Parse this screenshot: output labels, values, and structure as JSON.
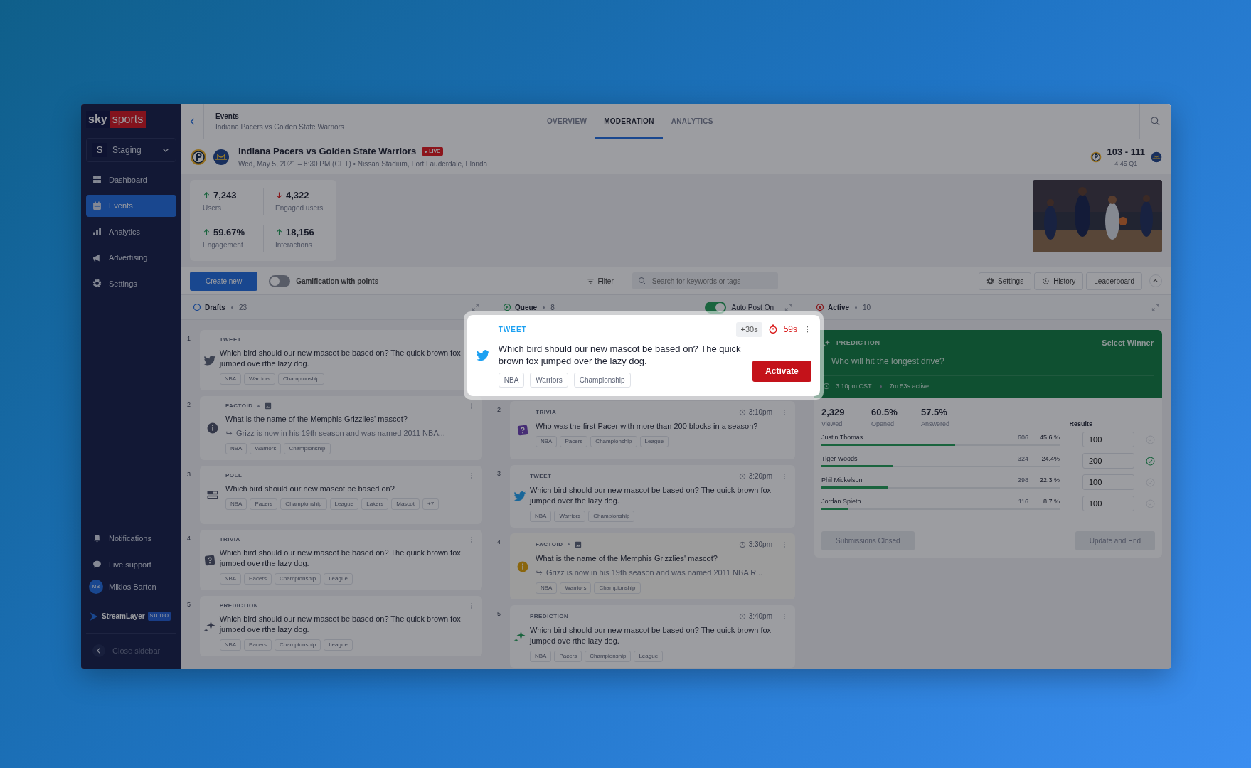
{
  "sidebar": {
    "brand": {
      "first": "sky",
      "second": "sports"
    },
    "workspace": {
      "initial": "S",
      "name": "Staging"
    },
    "nav": [
      {
        "label": "Dashboard",
        "kind": "grid",
        "selected": false
      },
      {
        "label": "Events",
        "kind": "calendar",
        "selected": true
      },
      {
        "label": "Analytics",
        "kind": "bars",
        "selected": false
      },
      {
        "label": "Advertising",
        "kind": "megaphone",
        "selected": false
      },
      {
        "label": "Settings",
        "kind": "gear",
        "selected": false
      }
    ],
    "bottom": [
      {
        "label": "Notifications",
        "kind": "bell"
      },
      {
        "label": "Live support",
        "kind": "chat"
      }
    ],
    "user": {
      "initials": "MB",
      "name": "Miklos Barton"
    },
    "footer": {
      "name": "StreamLayer",
      "badge": "STUDIO"
    },
    "close": "Close sidebar"
  },
  "header": {
    "breadcrumb": {
      "title": "Events",
      "subtitle": "Indiana Pacers vs Golden State Warriors"
    },
    "tabs": [
      {
        "label": "OVERVIEW",
        "selected": false
      },
      {
        "label": "MODERATION",
        "selected": true
      },
      {
        "label": "ANALYTICS",
        "selected": false
      }
    ],
    "event": {
      "title": "Indiana Pacers vs Golden State Warriors",
      "live": "LIVE",
      "meta": "Wed, May 5, 2021 – 8:30 PM (CET) • Nissan Stadium, Fort Lauderdale, Florida"
    },
    "score": {
      "value": "103 - 111",
      "clock": "4:45 Q1"
    }
  },
  "stats": [
    {
      "value": "7,243",
      "label": "Users",
      "rising": true
    },
    {
      "value": "4,322",
      "label": "Engaged users",
      "rising": false
    },
    {
      "value": "59.67%",
      "label": "Engagement",
      "rising": true
    },
    {
      "value": "18,156",
      "label": "Interactions",
      "rising": true
    }
  ],
  "toolbar": {
    "create": "Create new",
    "gamification": {
      "label": "Gamification with points",
      "on": false
    },
    "filter": "Filter",
    "search": {
      "placeholder": "Search for keywords or tags"
    },
    "buttons": [
      {
        "label": "Settings",
        "kind": "gear"
      },
      {
        "label": "History",
        "kind": "history"
      },
      {
        "label": "Leaderboard",
        "kind": "none"
      }
    ]
  },
  "drafts": {
    "title": "Drafts",
    "count": "23",
    "cards": [
      {
        "number": "1",
        "kind": "tweet",
        "type": "TWEET",
        "menu": false,
        "text": "Which bird should our new mascot be based on? The quick brown fox jumped ove rthe lazy dog.",
        "tags": [
          "NBA",
          "Warriors",
          "Championship"
        ]
      },
      {
        "number": "2",
        "kind": "factoid",
        "type": "FACTOID",
        "image": true,
        "text": "What is the name of the Memphis Grizzlies' mascot?",
        "subtext": "Grizz is now in his 19th season and was named 2011 NBA...",
        "tags": [
          "NBA",
          "Warriors",
          "Championship"
        ]
      },
      {
        "number": "3",
        "kind": "poll",
        "type": "POLL",
        "text": "Which bird should our new mascot be based on?",
        "tags": [
          "NBA",
          "Pacers",
          "Championship",
          "League",
          "Lakers",
          "Mascot",
          "+7"
        ]
      },
      {
        "number": "4",
        "kind": "trivia",
        "type": "TRIVIA",
        "text": "Which bird should our new mascot be based on? The quick brown fox jumped ove rthe lazy dog.",
        "tags": [
          "NBA",
          "Pacers",
          "Championship",
          "League"
        ]
      },
      {
        "number": "5",
        "kind": "prediction",
        "type": "PREDICTION",
        "text": "Which bird should our new mascot be based on? The quick brown fox jumped ove rthe lazy dog.",
        "tags": [
          "NBA",
          "Pacers",
          "Championship",
          "League"
        ]
      }
    ]
  },
  "queue": {
    "title": "Queue",
    "count": "8",
    "auto_post": {
      "label": "Auto Post On",
      "on": true
    },
    "cards": [
      {
        "number": "2",
        "kind": "trivia",
        "type": "TRIVIA",
        "time": "3:10pm",
        "text": "Who was the first Pacer with more than 200 blocks in a season?",
        "tags": [
          "NBA",
          "Pacers",
          "Championship",
          "League"
        ]
      },
      {
        "number": "3",
        "kind": "tweet",
        "type": "TWEET",
        "time": "3:20pm",
        "text": "Which bird should our new mascot be based on? The quick brown fox jumped over the lazy dog.",
        "tags": [
          "NBA",
          "Warriors",
          "Championship"
        ]
      },
      {
        "number": "4",
        "kind": "factoid",
        "type": "FACTOID",
        "image": true,
        "time": "3:30pm",
        "text": "What is the name of the Memphis Grizzlies' mascot?",
        "subtext": "Grizz is now in his 19th season and was named 2011 NBA R...",
        "tags": [
          "NBA",
          "Warriors",
          "Championship"
        ]
      },
      {
        "number": "5",
        "kind": "prediction",
        "type": "PREDICTION",
        "time": "3:40pm",
        "text": "Which bird should our new mascot be based on? The quick brown fox jumped ove rthe lazy dog.",
        "tags": [
          "NBA",
          "Pacers",
          "Championship",
          "League"
        ]
      }
    ]
  },
  "active": {
    "title": "Active",
    "count": "10",
    "card": {
      "type": "PREDICTION",
      "action": "Select Winner",
      "question": "Who will hit the longest drive?",
      "time": "3:10pm CST",
      "duration": "7m 53s active"
    },
    "metrics": [
      {
        "value": "2,329",
        "label": "Viewed"
      },
      {
        "value": "60.5%",
        "label": "Opened"
      },
      {
        "value": "57.5%",
        "label": "Answered"
      }
    ],
    "results_label": "Results",
    "options": [
      {
        "name": "Justin Thomas",
        "votes": "606",
        "percent": "45.6 %",
        "level": 0.56,
        "result": "100",
        "selected": false
      },
      {
        "name": "Tiger Woods",
        "votes": "324",
        "percent": "24.4%",
        "level": 0.3,
        "result": "200",
        "selected": true
      },
      {
        "name": "Phil Mickelson",
        "votes": "298",
        "percent": "22.3 %",
        "level": 0.28,
        "result": "100",
        "selected": false
      },
      {
        "name": "Jordan Spieth",
        "votes": "116",
        "percent": "8.7 %",
        "level": 0.11,
        "result": "100",
        "selected": false
      }
    ],
    "buttons": [
      "Submissions Closed",
      "Update and End"
    ]
  },
  "popup": {
    "kind": "tweet",
    "type": "TWEET",
    "extend": "+30s",
    "timer": "59s",
    "text": "Which bird should our new mascot be based on? The quick brown fox jumped over the lazy dog.",
    "tags": [
      "NBA",
      "Warriors",
      "Championship"
    ],
    "action": "Activate"
  }
}
